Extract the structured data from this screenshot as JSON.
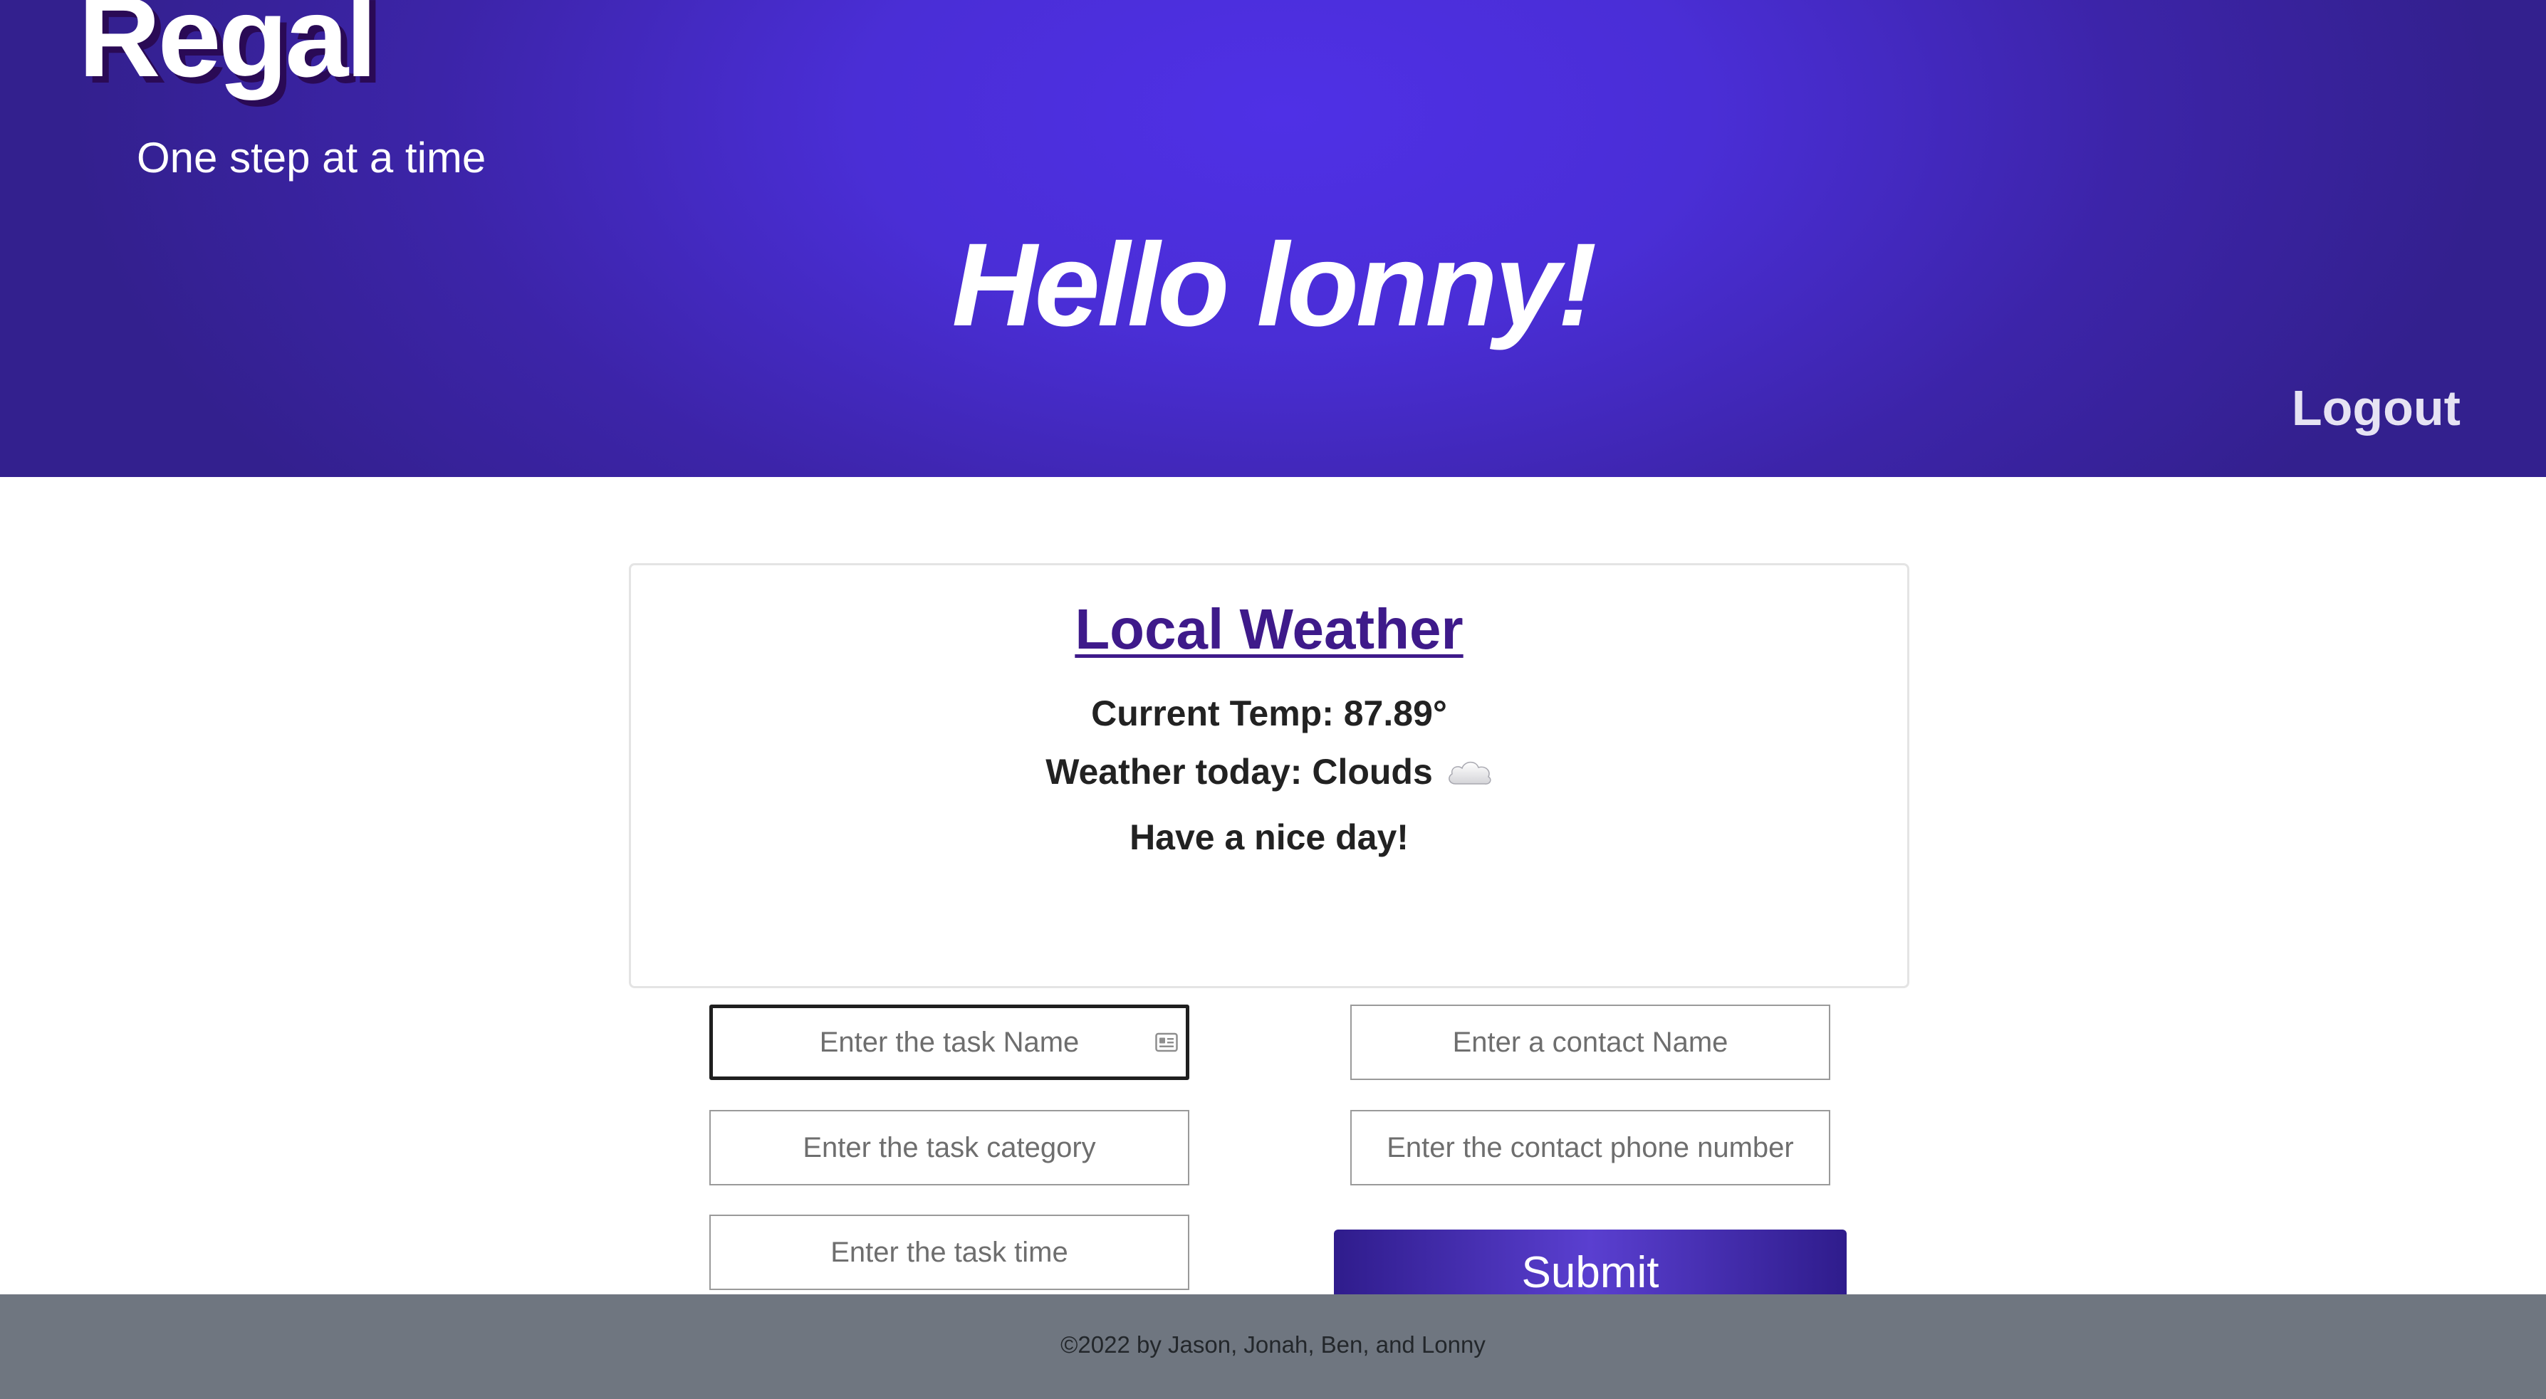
{
  "header": {
    "brand": "Regal",
    "tagline": "One step at a time",
    "greeting": "Hello lonny!",
    "logout_label": "Logout"
  },
  "weather": {
    "title": "Local Weather",
    "current_temp": "Current Temp: 87.89°",
    "weather_today": "Weather today: Clouds",
    "weather_icon": "cloud-icon",
    "message": "Have a nice day!"
  },
  "task_form": {
    "task_name_placeholder": "Enter the task Name",
    "task_category_placeholder": "Enter the task category",
    "task_time_placeholder": "Enter the task time",
    "autofill_icon": "contact-card-icon"
  },
  "contact_form": {
    "contact_name_placeholder": "Enter a contact Name",
    "contact_phone_placeholder": "Enter the contact phone number",
    "submit_label": "Submit"
  },
  "footer": {
    "copyright": "©2022 by Jason, Jonah, Ben, and Lonny"
  },
  "colors": {
    "header_accent": "#4a2ed6",
    "header_dark": "#33208e",
    "weather_title": "#3e1a8a",
    "footer_bg": "#6f7680"
  }
}
